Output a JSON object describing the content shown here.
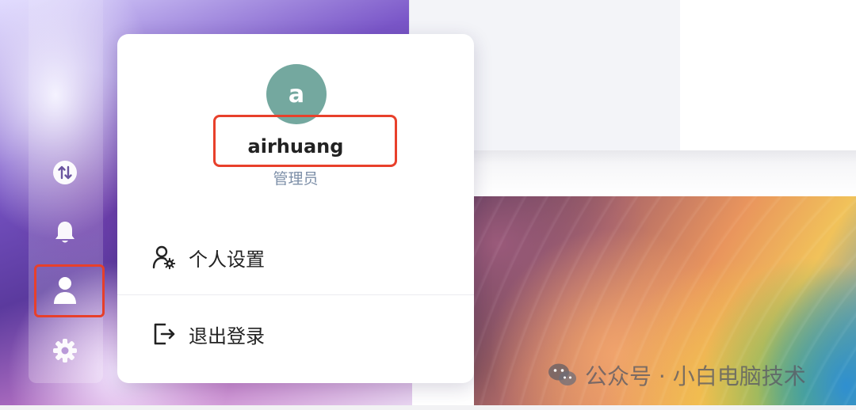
{
  "profile": {
    "avatar_letter": "a",
    "username": "airhuang",
    "role": "管理员"
  },
  "menu": {
    "items": [
      {
        "label": "个人设置",
        "icon": "user-settings-icon"
      },
      {
        "label": "退出登录",
        "icon": "logout-icon"
      }
    ]
  },
  "sidebar": {
    "items": [
      {
        "name": "transfer",
        "icon": "transfer-arrows-icon"
      },
      {
        "name": "notifications",
        "icon": "bell-icon"
      },
      {
        "name": "user",
        "icon": "user-icon",
        "active": true
      },
      {
        "name": "settings",
        "icon": "gear-icon"
      }
    ]
  },
  "watermark": {
    "text": "公众号 · 小白电脑技术"
  },
  "colors": {
    "avatar_bg": "#74a89f",
    "highlight": "#e8402b",
    "role_text": "#7d8fa8"
  }
}
